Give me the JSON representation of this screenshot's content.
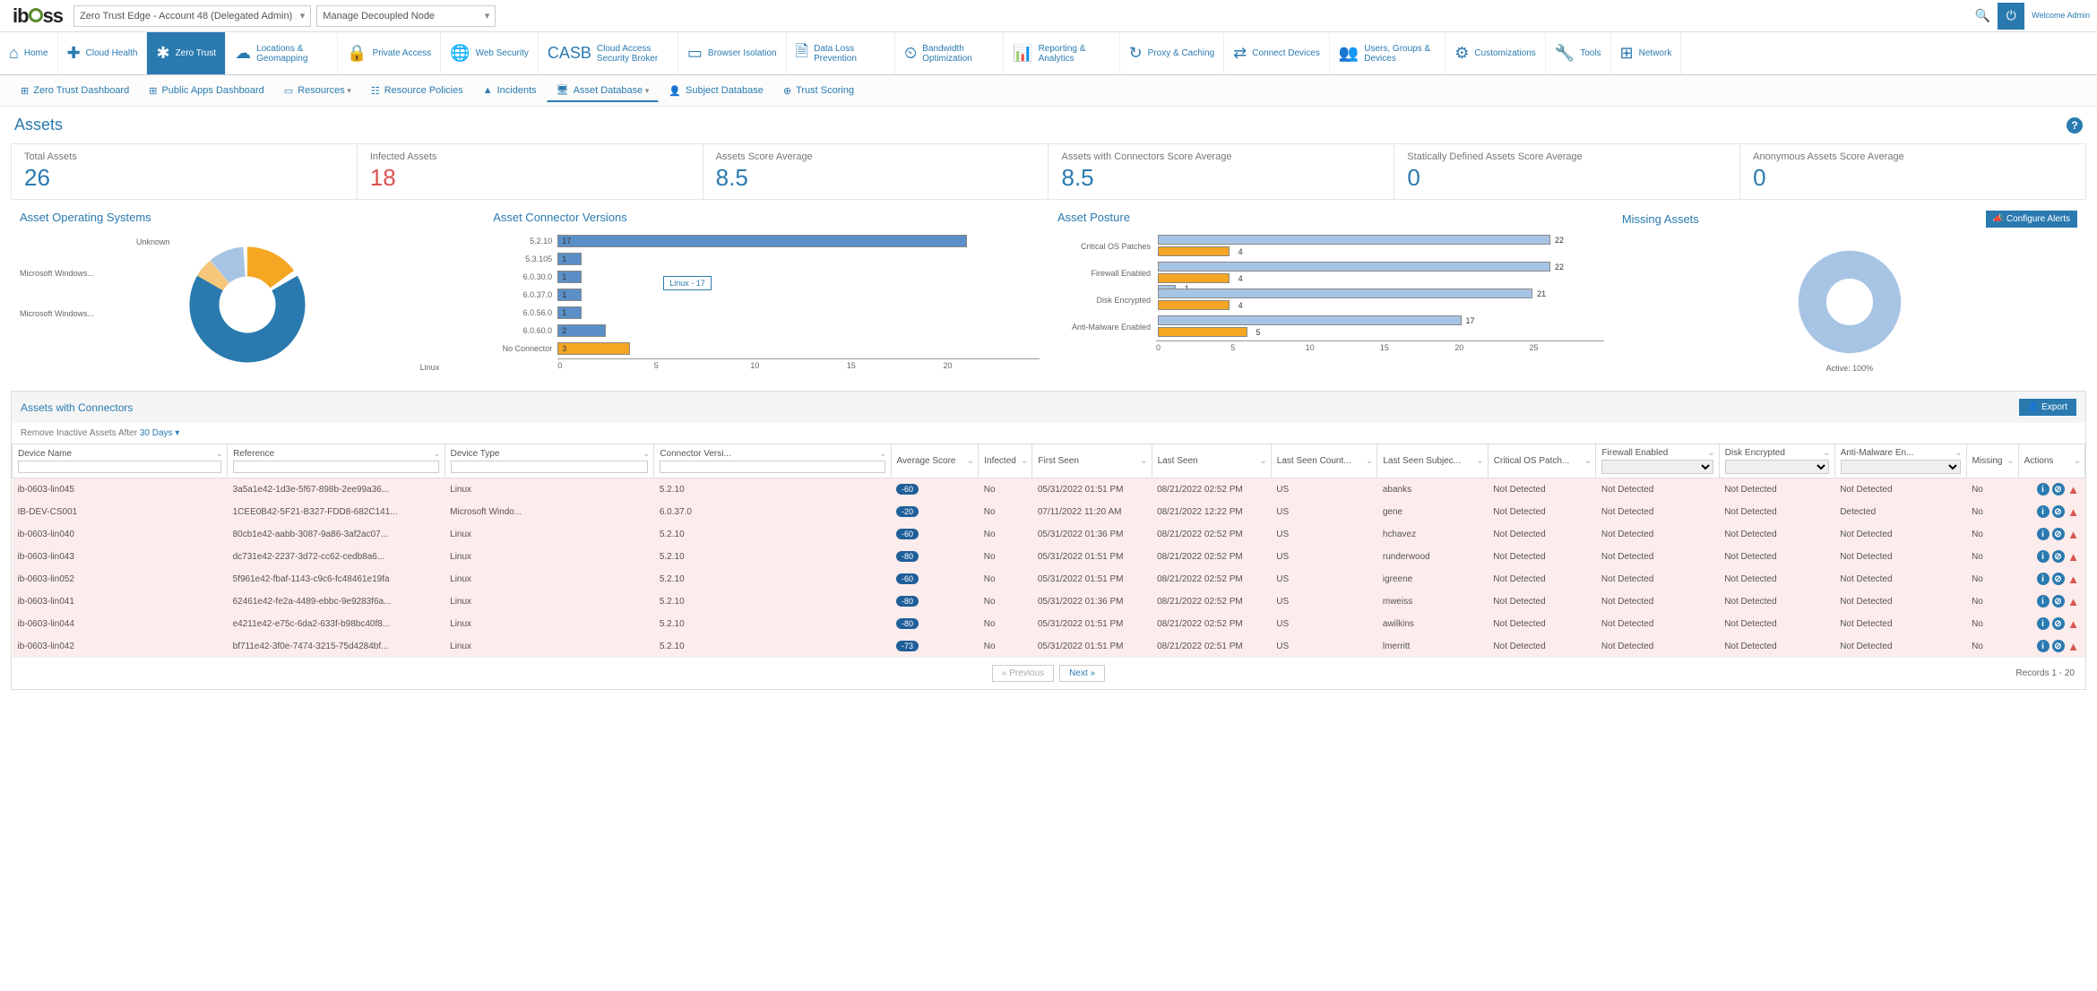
{
  "header": {
    "account_selector": "Zero Trust Edge - Account 48 (Delegated Admin)",
    "node_selector": "Manage Decoupled Node",
    "welcome": "Welcome Admin"
  },
  "nav": [
    {
      "label": "Home",
      "icon": "⌂"
    },
    {
      "label": "Cloud Health",
      "icon": "✚"
    },
    {
      "label": "Zero Trust",
      "icon": "✱",
      "active": true
    },
    {
      "label": "Locations & Geomapping",
      "icon": "☁"
    },
    {
      "label": "Private Access",
      "icon": "🔒"
    },
    {
      "label": "Web Security",
      "icon": "🌐"
    },
    {
      "label": "Cloud Access Security Broker",
      "icon": "CASB"
    },
    {
      "label": "Browser Isolation",
      "icon": "▭"
    },
    {
      "label": "Data Loss Prevention",
      "icon": "🗎"
    },
    {
      "label": "Bandwidth Optimization",
      "icon": "⏲"
    },
    {
      "label": "Reporting & Analytics",
      "icon": "📊"
    },
    {
      "label": "Proxy & Caching",
      "icon": "↻"
    },
    {
      "label": "Connect Devices",
      "icon": "⇄"
    },
    {
      "label": "Users, Groups & Devices",
      "icon": "👥"
    },
    {
      "label": "Customizations",
      "icon": "⚙"
    },
    {
      "label": "Tools",
      "icon": "🔧"
    },
    {
      "label": "Network",
      "icon": "⊞"
    }
  ],
  "subnav": [
    {
      "label": "Zero Trust Dashboard",
      "icon": "⊞"
    },
    {
      "label": "Public Apps Dashboard",
      "icon": "⊞"
    },
    {
      "label": "Resources",
      "icon": "▭",
      "dd": true
    },
    {
      "label": "Resource Policies",
      "icon": "☷"
    },
    {
      "label": "Incidents",
      "icon": "▲"
    },
    {
      "label": "Asset Database",
      "icon": "🖥",
      "dd": true,
      "active": true
    },
    {
      "label": "Subject Database",
      "icon": "👤"
    },
    {
      "label": "Trust Scoring",
      "icon": "⊕"
    }
  ],
  "page_title": "Assets",
  "stats": [
    {
      "label": "Total Assets",
      "value": "26"
    },
    {
      "label": "Infected Assets",
      "value": "18",
      "red": true
    },
    {
      "label": "Assets Score Average",
      "value": "8.5"
    },
    {
      "label": "Assets with Connectors Score Average",
      "value": "8.5"
    },
    {
      "label": "Statically Defined Assets Score Average",
      "value": "0"
    },
    {
      "label": "Anonymous Assets Score Average",
      "value": "0"
    }
  ],
  "chart_data": [
    {
      "type": "pie",
      "title": "Asset Operating Systems",
      "series": [
        {
          "name": "Linux",
          "value": 70,
          "color": "#2a7ab0"
        },
        {
          "name": "Microsoft Windows...",
          "value": 15,
          "color": "#f5a623"
        },
        {
          "name": "Microsoft Windows...",
          "value": 10,
          "color": "#a8c4e5"
        },
        {
          "name": "Unknown",
          "value": 5,
          "color": "#f7c77a"
        }
      ]
    },
    {
      "type": "bar",
      "title": "Asset Connector Versions",
      "orientation": "horizontal",
      "categories": [
        "5.2.10",
        "5.3.105",
        "6.0.30.0",
        "6.0.37.0",
        "6.0.56.0",
        "6.0.60.0",
        "No Connector"
      ],
      "values": [
        17,
        1,
        1,
        1,
        1,
        2,
        3
      ],
      "xlim": [
        0,
        20
      ],
      "xticks": [
        0,
        5,
        10,
        15,
        20
      ],
      "tooltip": "Linux - 17"
    },
    {
      "type": "bar",
      "title": "Asset Posture",
      "orientation": "horizontal",
      "categories": [
        "Critical OS Patches",
        "Firewall Enabled",
        "Disk Encrypted",
        "Anti-Malware Enabled"
      ],
      "series": [
        {
          "name": "unlabeled-blue",
          "values": [
            22,
            22,
            21,
            17
          ],
          "color": "#a8c4e5"
        },
        {
          "name": "unlabeled-orange",
          "values": [
            4,
            4,
            4,
            5
          ],
          "color": "#f5a623"
        }
      ],
      "extra_points": {
        "Firewall Enabled": {
          "value": 1
        }
      },
      "xlim": [
        0,
        25
      ],
      "xticks": [
        0,
        5,
        10,
        15,
        20,
        25
      ]
    },
    {
      "type": "pie",
      "title": "Missing Assets",
      "series": [
        {
          "name": "Active",
          "value": 100,
          "color": "#a8c4e5"
        }
      ],
      "caption": "Active: 100%",
      "button": "Configure Alerts"
    }
  ],
  "table": {
    "title": "Assets with Connectors",
    "export": "Export",
    "filter_text": "Remove Inactive Assets After ",
    "filter_link": "30 Days",
    "columns": [
      "Device Name",
      "Reference",
      "Device Type",
      "Connector Versi...",
      "Average Score",
      "Infected",
      "First Seen",
      "Last Seen",
      "Last Seen Count...",
      "Last Seen Subjec...",
      "Critical OS Patch...",
      "Firewall Enabled",
      "Disk Encrypted",
      "Anti-Malware En...",
      "Missing",
      "Actions"
    ],
    "has_filter_input": [
      true,
      true,
      true,
      true,
      false,
      false,
      false,
      false,
      false,
      false,
      false,
      true,
      true,
      true,
      false,
      false
    ],
    "filter_type": [
      "text",
      "text",
      "text",
      "text",
      "",
      "",
      "",
      "",
      "",
      "",
      "",
      "select",
      "select",
      "select",
      "",
      ""
    ],
    "rows": [
      {
        "device": "ib-0603-lin045",
        "ref": "3a5a1e42-1d3e-5f67-898b-2ee99a36...",
        "type": "Linux",
        "ver": "5.2.10",
        "score": "-60",
        "infected": "No",
        "first": "05/31/2022 01:51 PM",
        "last": "08/21/2022 02:52 PM",
        "country": "US",
        "subject": "abanks",
        "patches": "Not Detected",
        "firewall": "Not Detected",
        "disk": "Not Detected",
        "am": "Not Detected",
        "missing": "No"
      },
      {
        "device": "IB-DEV-CS001",
        "ref": "1CEE0B42-5F21-B327-FDD8-682C141...",
        "type": "Microsoft Windo...",
        "ver": "6.0.37.0",
        "score": "-20",
        "infected": "No",
        "first": "07/11/2022 11:20 AM",
        "last": "08/21/2022 12:22 PM",
        "country": "US",
        "subject": "gene",
        "patches": "Not Detected",
        "firewall": "Not Detected",
        "disk": "Not Detected",
        "am": "Detected",
        "missing": "No"
      },
      {
        "device": "ib-0603-lin040",
        "ref": "80cb1e42-aabb-3087-9a86-3af2ac07...",
        "type": "Linux",
        "ver": "5.2.10",
        "score": "-60",
        "infected": "No",
        "first": "05/31/2022 01:36 PM",
        "last": "08/21/2022 02:52 PM",
        "country": "US",
        "subject": "hchavez",
        "patches": "Not Detected",
        "firewall": "Not Detected",
        "disk": "Not Detected",
        "am": "Not Detected",
        "missing": "No"
      },
      {
        "device": "ib-0603-lin043",
        "ref": "dc731e42-2237-3d72-cc62-cedb8a6...",
        "type": "Linux",
        "ver": "5.2.10",
        "score": "-80",
        "infected": "No",
        "first": "05/31/2022 01:51 PM",
        "last": "08/21/2022 02:52 PM",
        "country": "US",
        "subject": "runderwood",
        "patches": "Not Detected",
        "firewall": "Not Detected",
        "disk": "Not Detected",
        "am": "Not Detected",
        "missing": "No"
      },
      {
        "device": "ib-0603-lin052",
        "ref": "5f961e42-fbaf-1143-c9c6-fc48461e19fa",
        "type": "Linux",
        "ver": "5.2.10",
        "score": "-60",
        "infected": "No",
        "first": "05/31/2022 01:51 PM",
        "last": "08/21/2022 02:52 PM",
        "country": "US",
        "subject": "igreene",
        "patches": "Not Detected",
        "firewall": "Not Detected",
        "disk": "Not Detected",
        "am": "Not Detected",
        "missing": "No"
      },
      {
        "device": "ib-0603-lin041",
        "ref": "62461e42-fe2a-4489-ebbc-9e9283f6a...",
        "type": "Linux",
        "ver": "5.2.10",
        "score": "-80",
        "infected": "No",
        "first": "05/31/2022 01:36 PM",
        "last": "08/21/2022 02:52 PM",
        "country": "US",
        "subject": "mweiss",
        "patches": "Not Detected",
        "firewall": "Not Detected",
        "disk": "Not Detected",
        "am": "Not Detected",
        "missing": "No"
      },
      {
        "device": "ib-0603-lin044",
        "ref": "e4211e42-e75c-6da2-633f-b98bc40f8...",
        "type": "Linux",
        "ver": "5.2.10",
        "score": "-80",
        "infected": "No",
        "first": "05/31/2022 01:51 PM",
        "last": "08/21/2022 02:52 PM",
        "country": "US",
        "subject": "awilkins",
        "patches": "Not Detected",
        "firewall": "Not Detected",
        "disk": "Not Detected",
        "am": "Not Detected",
        "missing": "No"
      },
      {
        "device": "ib-0603-lin042",
        "ref": "bf711e42-3f0e-7474-3215-75d4284bf...",
        "type": "Linux",
        "ver": "5.2.10",
        "score": "-73",
        "infected": "No",
        "first": "05/31/2022 01:51 PM",
        "last": "08/21/2022 02:51 PM",
        "country": "US",
        "subject": "lmerritt",
        "patches": "Not Detected",
        "firewall": "Not Detected",
        "disk": "Not Detected",
        "am": "Not Detected",
        "missing": "No"
      }
    ],
    "prev": "« Previous",
    "next": "Next »",
    "records": "Records 1 - 20"
  }
}
